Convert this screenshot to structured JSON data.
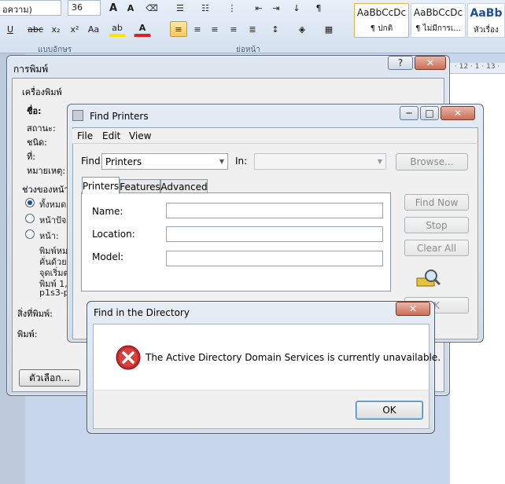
{
  "ribbon": {
    "font_name": "อความ)",
    "font_size": "36",
    "grow_font": "A",
    "shrink_font": "A",
    "underline": "U",
    "strike": "abc",
    "subscript": "x₂",
    "superscript": "x²",
    "change_case": "Aa",
    "highlight": "ab",
    "font_color": "A",
    "group_font_label": "แบบอักษร",
    "group_paragraph_label": "ย่อหน้า",
    "styles": [
      {
        "sample": "AaBbCcDc",
        "name": "¶ ปกติ"
      },
      {
        "sample": "AaBbCcDc",
        "name": "¶ ไม่มีการเ..."
      },
      {
        "sample": "AaBb",
        "name": "หัวเรื่อง"
      }
    ],
    "ruler_text": "· 12 · 1 · 13 ·"
  },
  "print_dialog": {
    "title": "การพิมพ์",
    "help": "?",
    "close": "✕",
    "printer_group": "เครื่องพิมพ์",
    "name_label": "ชื่อ:",
    "status_label": "สถานะ:",
    "type_label": "ชนิด:",
    "where_label": "ที่:",
    "comment_label": "หมายเหตุ:",
    "range_group": "ช่วงของหน้า",
    "all_option": "ทั้งหมด",
    "current_option": "หน้าปัจจุ",
    "pages_option": "หน้า:",
    "hint_lines": [
      "พิมพ์หม",
      "คั่นด้วยเ",
      "จุดเริ่มต",
      "พิมพ์ 1,",
      "p1s3-p"
    ],
    "print_what_label": "สิ่งที่พิมพ์:",
    "print_label": "พิมพ์:",
    "options_button": "ตัวเลือก..."
  },
  "find_printers": {
    "title": "Find Printers",
    "minimize": "─",
    "maximize": "□",
    "close": "✕",
    "menu": [
      "File",
      "Edit",
      "View"
    ],
    "find_label": "Find:",
    "find_value": "Printers",
    "in_label": "In:",
    "in_value": "",
    "browse_button": "Browse...",
    "tabs": [
      "Printers",
      "Features",
      "Advanced"
    ],
    "active_tab": "Printers",
    "name_label": "Name:",
    "location_label": "Location:",
    "model_label": "Model:",
    "name_value": "",
    "location_value": "",
    "model_value": "",
    "find_now_button": "Find Now",
    "stop_button": "Stop",
    "clear_all_button": "Clear All",
    "ok_partial": "K"
  },
  "error_dialog": {
    "title": "Find in the Directory",
    "close": "✕",
    "message": "The Active Directory Domain Services is currently unavailable.",
    "ok_button": "OK"
  },
  "colors": {
    "error_red": "#c62828",
    "highlight_yellow": "#ffe400",
    "font_red": "#e02020",
    "style_blue": "#1f4e9a"
  }
}
